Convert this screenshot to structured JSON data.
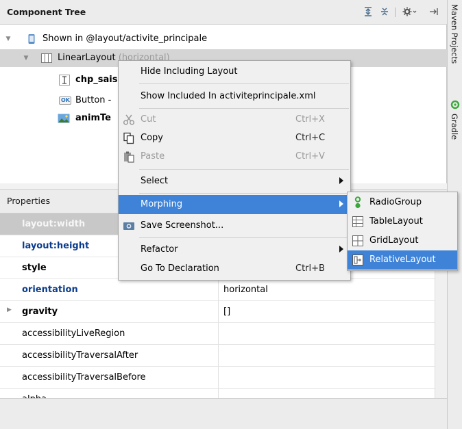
{
  "tree": {
    "title": "Component Tree",
    "rows": [
      {
        "label": "Shown in @layout/activite_principale"
      },
      {
        "label": "LinearLayout",
        "suffix": "(horizontal)"
      },
      {
        "label": "chp_sais"
      },
      {
        "label": "Button -"
      },
      {
        "label": "animTe"
      }
    ],
    "icons": {
      "button_badge": "OK"
    }
  },
  "properties": {
    "title": "Properties",
    "rows": [
      {
        "name": "layout:width",
        "value": ""
      },
      {
        "name": "layout:height",
        "value": ""
      },
      {
        "name": "style",
        "value": ""
      },
      {
        "name": "orientation",
        "value": "horizontal"
      },
      {
        "name": "gravity",
        "value": "[]"
      },
      {
        "name": "accessibilityLiveRegion",
        "value": ""
      },
      {
        "name": "accessibilityTraversalAfter",
        "value": ""
      },
      {
        "name": "accessibilityTraversalBefore",
        "value": ""
      },
      {
        "name": "alpha",
        "value": ""
      }
    ]
  },
  "right_strip": {
    "maven": "Maven Projects",
    "gradle": "Gradle"
  },
  "context_menu": {
    "items": [
      {
        "label": "Hide Including Layout",
        "shortcut": ""
      },
      {
        "label": "Show Included In activiteprincipale.xml",
        "shortcut": ""
      },
      {
        "label": "Cut",
        "shortcut": "Ctrl+X"
      },
      {
        "label": "Copy",
        "shortcut": "Ctrl+C"
      },
      {
        "label": "Paste",
        "shortcut": "Ctrl+V"
      },
      {
        "label": "Select",
        "shortcut": ""
      },
      {
        "label": "Morphing",
        "shortcut": ""
      },
      {
        "label": "Save Screenshot...",
        "shortcut": ""
      },
      {
        "label": "Refactor",
        "shortcut": ""
      },
      {
        "label": "Go To Declaration",
        "shortcut": "Ctrl+B"
      }
    ]
  },
  "submenu": {
    "items": [
      {
        "label": "RadioGroup"
      },
      {
        "label": "TableLayout"
      },
      {
        "label": "GridLayout"
      },
      {
        "label": "RelativeLayout"
      }
    ]
  },
  "colors": {
    "highlight": "#3e83d8",
    "property_blue": "#0b3c8c",
    "gradle_green": "#3aa83a"
  }
}
